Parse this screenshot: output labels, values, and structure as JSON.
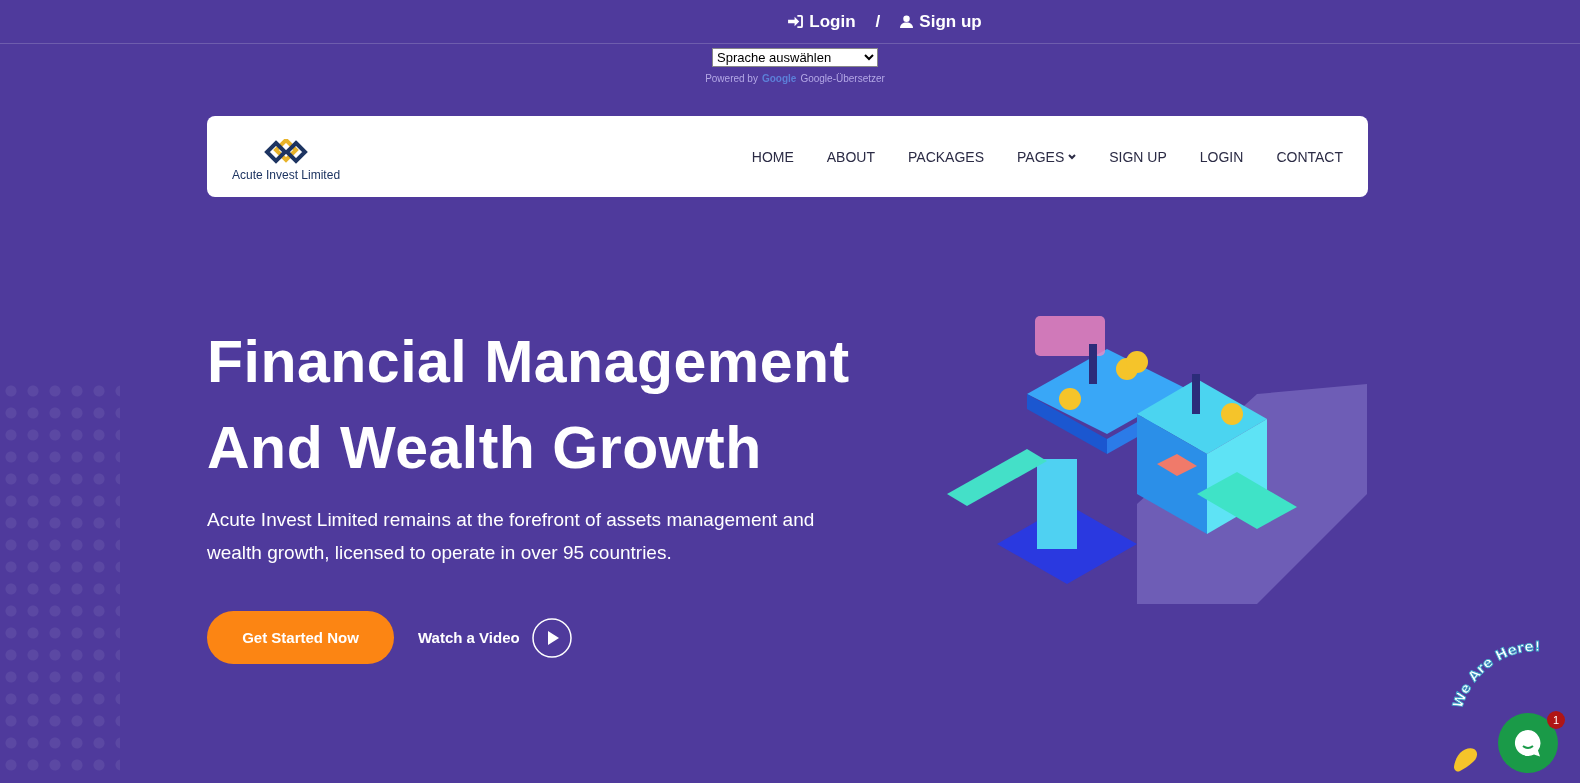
{
  "top_bar": {
    "login": "Login",
    "separator": "/",
    "signup": "Sign up"
  },
  "translate": {
    "select_value": "Sprache auswählen",
    "powered_by": "Powered by",
    "google": "Google",
    "translator": "Google-Übersetzer"
  },
  "navbar": {
    "logo_text": "Acute Invest Limited",
    "items": [
      {
        "label": "HOME",
        "dropdown": false
      },
      {
        "label": "ABOUT",
        "dropdown": false
      },
      {
        "label": "PACKAGES",
        "dropdown": false
      },
      {
        "label": "PAGES",
        "dropdown": true
      },
      {
        "label": "SIGN UP",
        "dropdown": false
      },
      {
        "label": "LOGIN",
        "dropdown": false
      },
      {
        "label": "CONTACT",
        "dropdown": false
      }
    ]
  },
  "hero": {
    "title_lines": [
      "Financial Management",
      "And Wealth Growth"
    ],
    "description": "Acute Invest Limited remains at the forefront of assets management and wealth growth, licensed to operate in over 95 countries.",
    "primary_button": "Get Started Now",
    "video_link": "Watch a Video"
  },
  "chat_widget": {
    "banner": "We Are Here!",
    "badge": "1"
  }
}
